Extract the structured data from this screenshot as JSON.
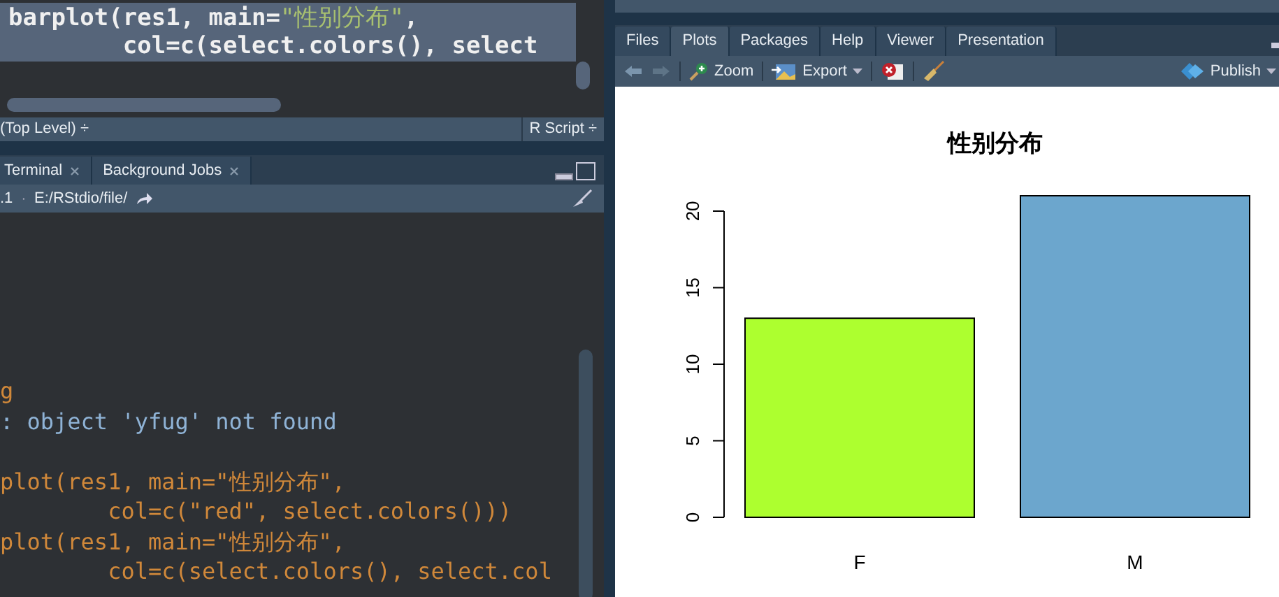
{
  "editor": {
    "lines": [
      [
        {
          "kind": "code",
          "text": "barplot(res1, main="
        },
        {
          "kind": "string",
          "text": "\"性别分布\""
        },
        {
          "kind": "code",
          "text": ","
        }
      ],
      [
        {
          "kind": "code",
          "text": "        col=c(select.colors(), select"
        }
      ]
    ],
    "scope": "(Top Level) ÷",
    "file_type": "R Script ÷"
  },
  "console": {
    "tabs": [
      {
        "label": "Terminal",
        "selected": false
      },
      {
        "label": "Background Jobs",
        "selected": false
      }
    ],
    "version": ".1",
    "separator": "·",
    "path": "E:/RStdio/file/",
    "lines": [
      {
        "kind": "input",
        "text": "g"
      },
      {
        "kind": "error",
        "text": ": object 'yfug' not found"
      },
      {
        "kind": "blank"
      },
      {
        "kind": "input",
        "text": "plot(res1, main=\"性别分布\","
      },
      {
        "kind": "input",
        "text": "        col=c(\"red\", select.colors()))"
      },
      {
        "kind": "input",
        "text": "plot(res1, main=\"性别分布\","
      },
      {
        "kind": "input",
        "text": "        col=c(select.colors(), select.col"
      }
    ]
  },
  "right_pane": {
    "tabs": [
      {
        "label": "Files",
        "selected": false
      },
      {
        "label": "Plots",
        "selected": true
      },
      {
        "label": "Packages",
        "selected": false
      },
      {
        "label": "Help",
        "selected": false
      },
      {
        "label": "Viewer",
        "selected": false
      },
      {
        "label": "Presentation",
        "selected": false
      }
    ],
    "toolbar": {
      "zoom": "Zoom",
      "export": "Export",
      "publish": "Publish"
    },
    "chart_data": {
      "type": "bar",
      "title": "性别分布",
      "categories": [
        "F",
        "M"
      ],
      "values": [
        13,
        21
      ],
      "colors": [
        "#adff2f",
        "#6ca6cd"
      ],
      "ylim": [
        0,
        21
      ],
      "yticks": [
        0,
        5,
        10,
        15,
        20
      ]
    }
  }
}
